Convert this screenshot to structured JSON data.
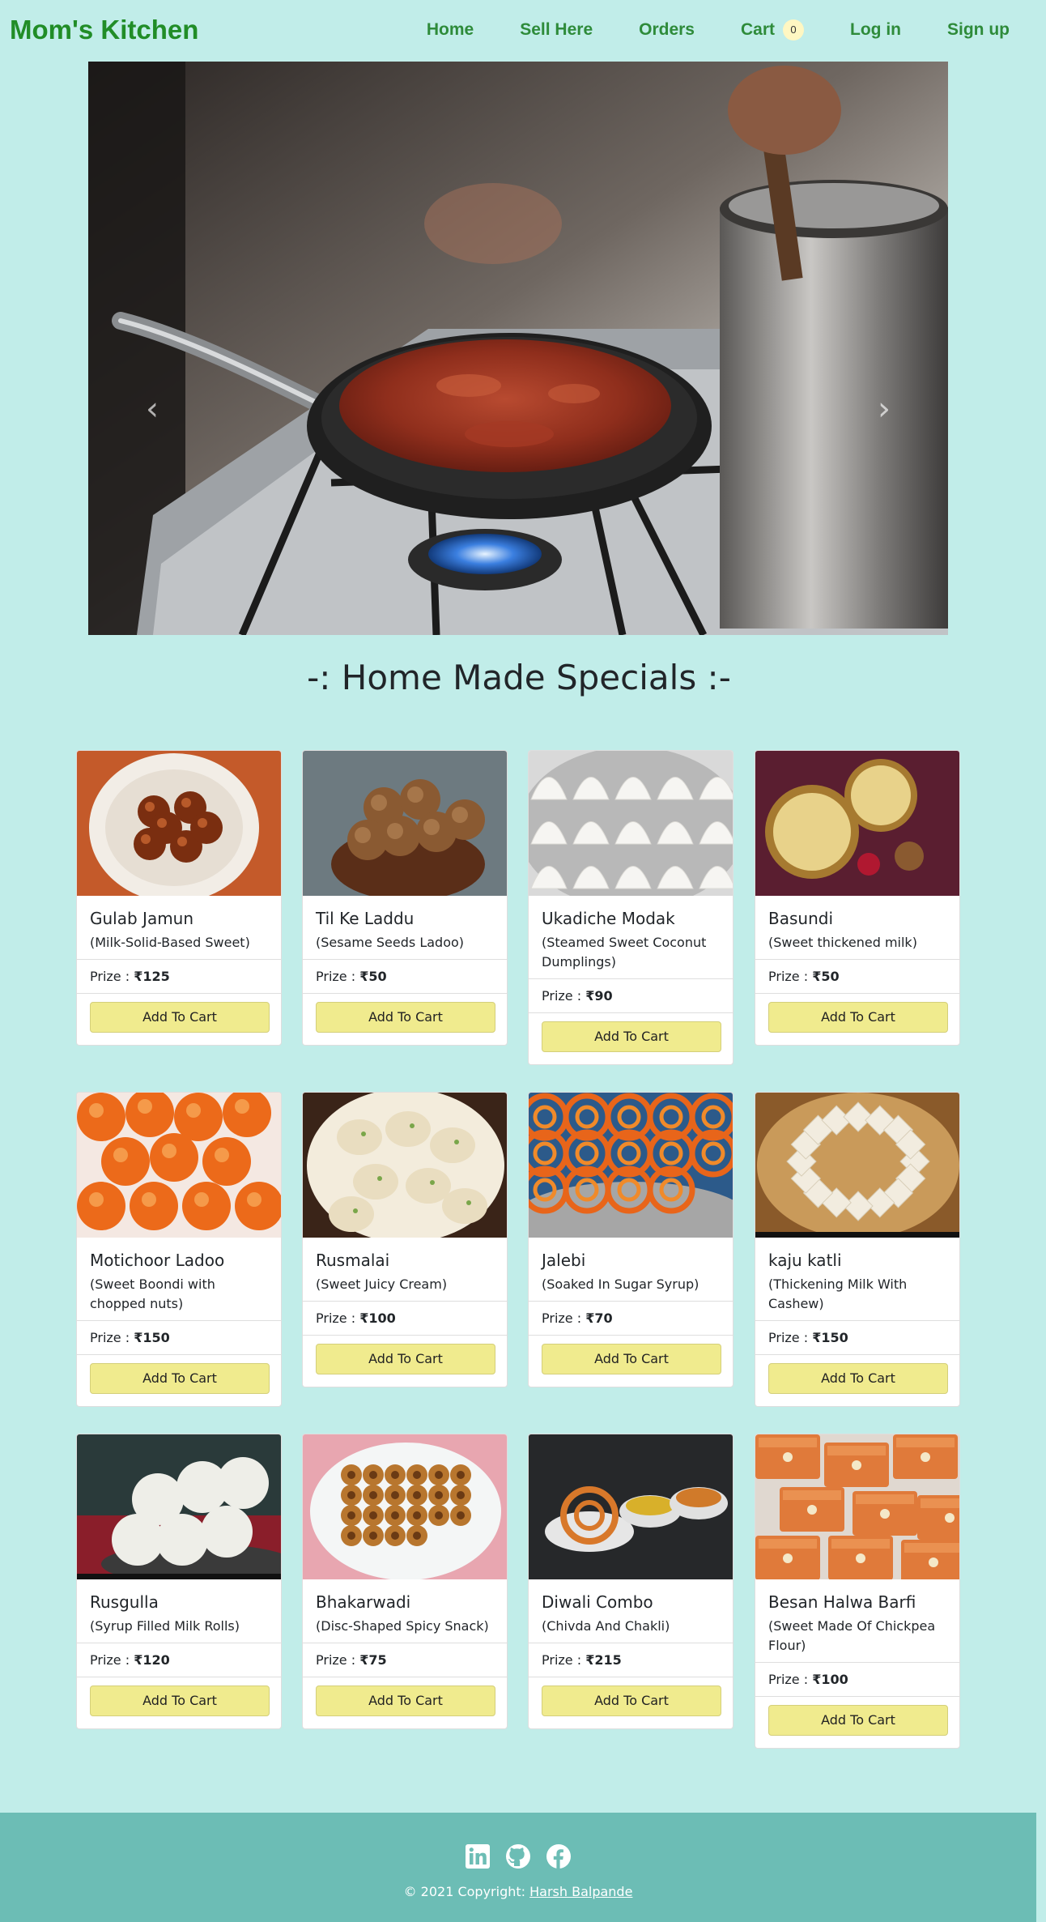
{
  "nav": {
    "brand": "Mom's Kitchen",
    "links": [
      "Home",
      "Sell Here",
      "Orders",
      "Cart",
      "Log in",
      "Sign up"
    ],
    "cart_count": "0"
  },
  "carousel": {
    "prev_icon": "chevron-left-icon",
    "next_icon": "chevron-right-icon",
    "slide_alt": "cooking-on-stove-photo"
  },
  "section": {
    "heading": "-: Home Made Specials :-"
  },
  "price_prefix": "Prize : ",
  "button_label": "Add To Cart",
  "products": [
    {
      "name": "Gulab Jamun",
      "desc": "(Milk-Solid-Based Sweet)",
      "price": "₹125"
    },
    {
      "name": "Til Ke Laddu",
      "desc": "(Sesame Seeds Ladoo)",
      "price": "₹50"
    },
    {
      "name": "Ukadiche Modak",
      "desc": "(Steamed Sweet Coconut Dumplings)",
      "price": "₹90"
    },
    {
      "name": "Basundi",
      "desc": "(Sweet thickened milk)",
      "price": "₹50"
    },
    {
      "name": "Motichoor Ladoo",
      "desc": "(Sweet Boondi with chopped nuts)",
      "price": "₹150"
    },
    {
      "name": "Rusmalai",
      "desc": "(Sweet Juicy Cream)",
      "price": "₹100"
    },
    {
      "name": "Jalebi",
      "desc": "(Soaked In Sugar Syrup)",
      "price": "₹70"
    },
    {
      "name": "kaju katli",
      "desc": "(Thickening Milk With Cashew)",
      "price": "₹150"
    },
    {
      "name": "Rusgulla",
      "desc": "(Syrup Filled Milk Rolls)",
      "price": "₹120"
    },
    {
      "name": "Bhakarwadi",
      "desc": "(Disc-Shaped Spicy Snack)",
      "price": "₹75"
    },
    {
      "name": "Diwali Combo",
      "desc": "(Chivda And Chakli)",
      "price": "₹215"
    },
    {
      "name": "Besan Halwa Barfi",
      "desc": "(Sweet Made Of Chickpea Flour)",
      "price": "₹100"
    }
  ],
  "footer": {
    "icons": [
      "linkedin-icon",
      "github-icon",
      "facebook-icon"
    ],
    "copyright": "© 2021 Copyright: ",
    "author": "Harsh Balpande"
  },
  "colors": {
    "page_bg": "#c1ede9",
    "brand": "#218d27",
    "footer_bg": "#6cbdb5",
    "button_bg": "#f0eb8e"
  }
}
